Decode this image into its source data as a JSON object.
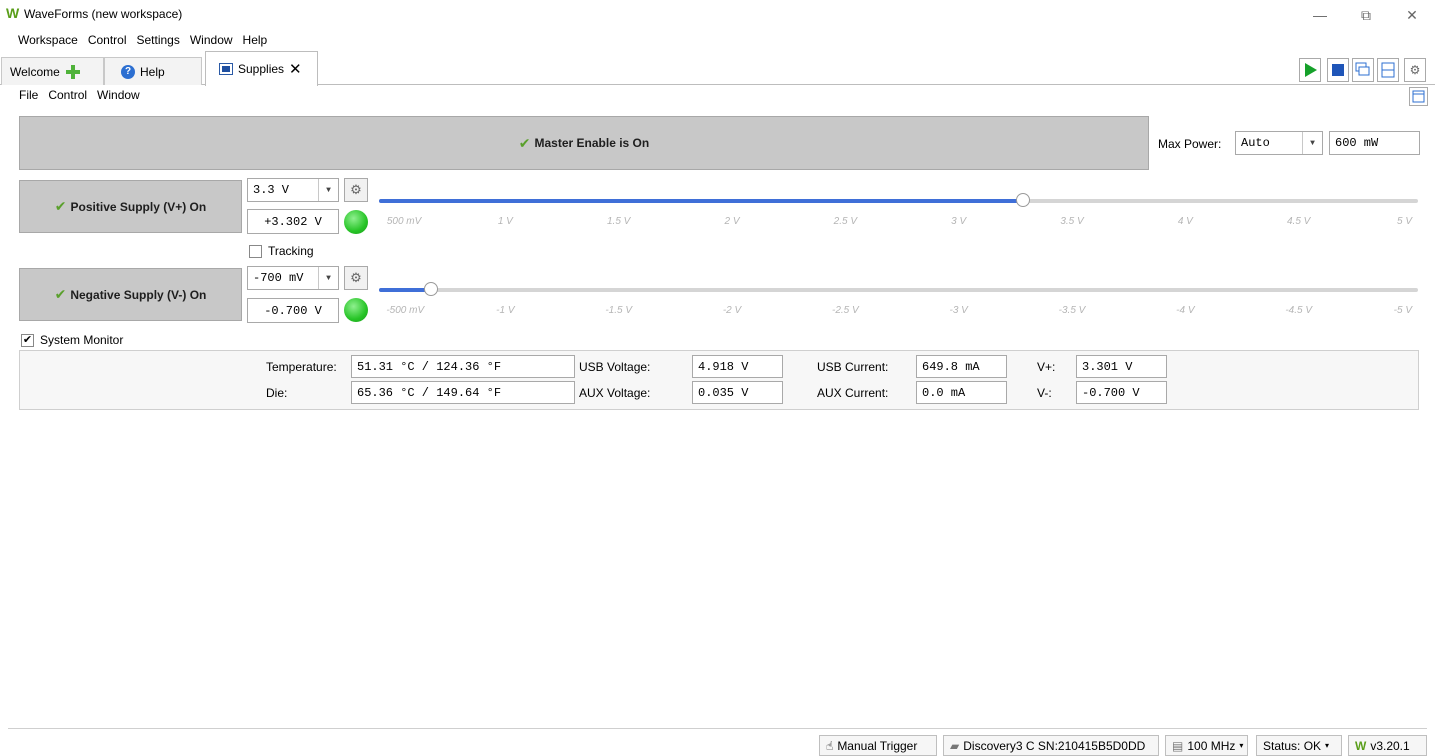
{
  "window": {
    "title": "WaveForms (new workspace)",
    "logo": "W",
    "controls": {
      "minimize": "—",
      "restore": "⧉",
      "close": "✕"
    }
  },
  "main_menu": [
    "Workspace",
    "Control",
    "Settings",
    "Window",
    "Help"
  ],
  "tabs": [
    {
      "label": "Welcome",
      "icon": "plus-icon"
    },
    {
      "label": "Help",
      "icon": "help-icon"
    },
    {
      "label": "Supplies",
      "icon": "supplies-icon",
      "active": true,
      "close": "✕"
    }
  ],
  "sub_menu": [
    "File",
    "Control",
    "Window"
  ],
  "master": {
    "label": "Master Enable is On",
    "max_power_label": "Max Power:",
    "max_power_mode": "Auto",
    "max_power_value": "600 mW"
  },
  "positive": {
    "label": "Positive Supply (V+) On",
    "setpoint": "3.3 V",
    "reading": "+3.302 V",
    "slider_fraction": 0.62,
    "ticks": [
      "500 mV",
      "1 V",
      "1.5 V",
      "2 V",
      "2.5 V",
      "3 V",
      "3.5 V",
      "4 V",
      "4.5 V",
      "5 V"
    ]
  },
  "tracking_label": "Tracking",
  "negative": {
    "label": "Negative Supply (V-) On",
    "setpoint": "-700 mV",
    "reading": "-0.700 V",
    "slider_fraction": 0.05,
    "ticks": [
      "-500 mV",
      "-1 V",
      "-1.5 V",
      "-2 V",
      "-2.5 V",
      "-3 V",
      "-3.5 V",
      "-4 V",
      "-4.5 V",
      "-5 V"
    ]
  },
  "system_monitor": {
    "label": "System Monitor",
    "checked": true,
    "temperature_label": "Temperature:",
    "temperature": "51.31 °C / 124.36 °F",
    "die_label": "Die:",
    "die": "65.36 °C / 149.64 °F",
    "usb_voltage_label": "USB Voltage:",
    "usb_voltage": "4.918 V",
    "aux_voltage_label": "AUX Voltage:",
    "aux_voltage": "0.035 V",
    "usb_current_label": "USB Current:",
    "usb_current": "649.8 mA",
    "aux_current_label": "AUX Current:",
    "aux_current": "0.0 mA",
    "vplus_label": "V+:",
    "vplus": "3.301 V",
    "vminus_label": "V-:",
    "vminus": "-0.700 V"
  },
  "statusbar": {
    "manual_trigger": "Manual Trigger",
    "device": "Discovery3 C SN:210415B5D0DD",
    "clock": "100 MHz",
    "status": "Status: OK",
    "version": "v3.20.1"
  },
  "colors": {
    "accent_green": "#4fb23a",
    "slider_blue": "#3f6fd8",
    "led_green": "#27c427"
  }
}
